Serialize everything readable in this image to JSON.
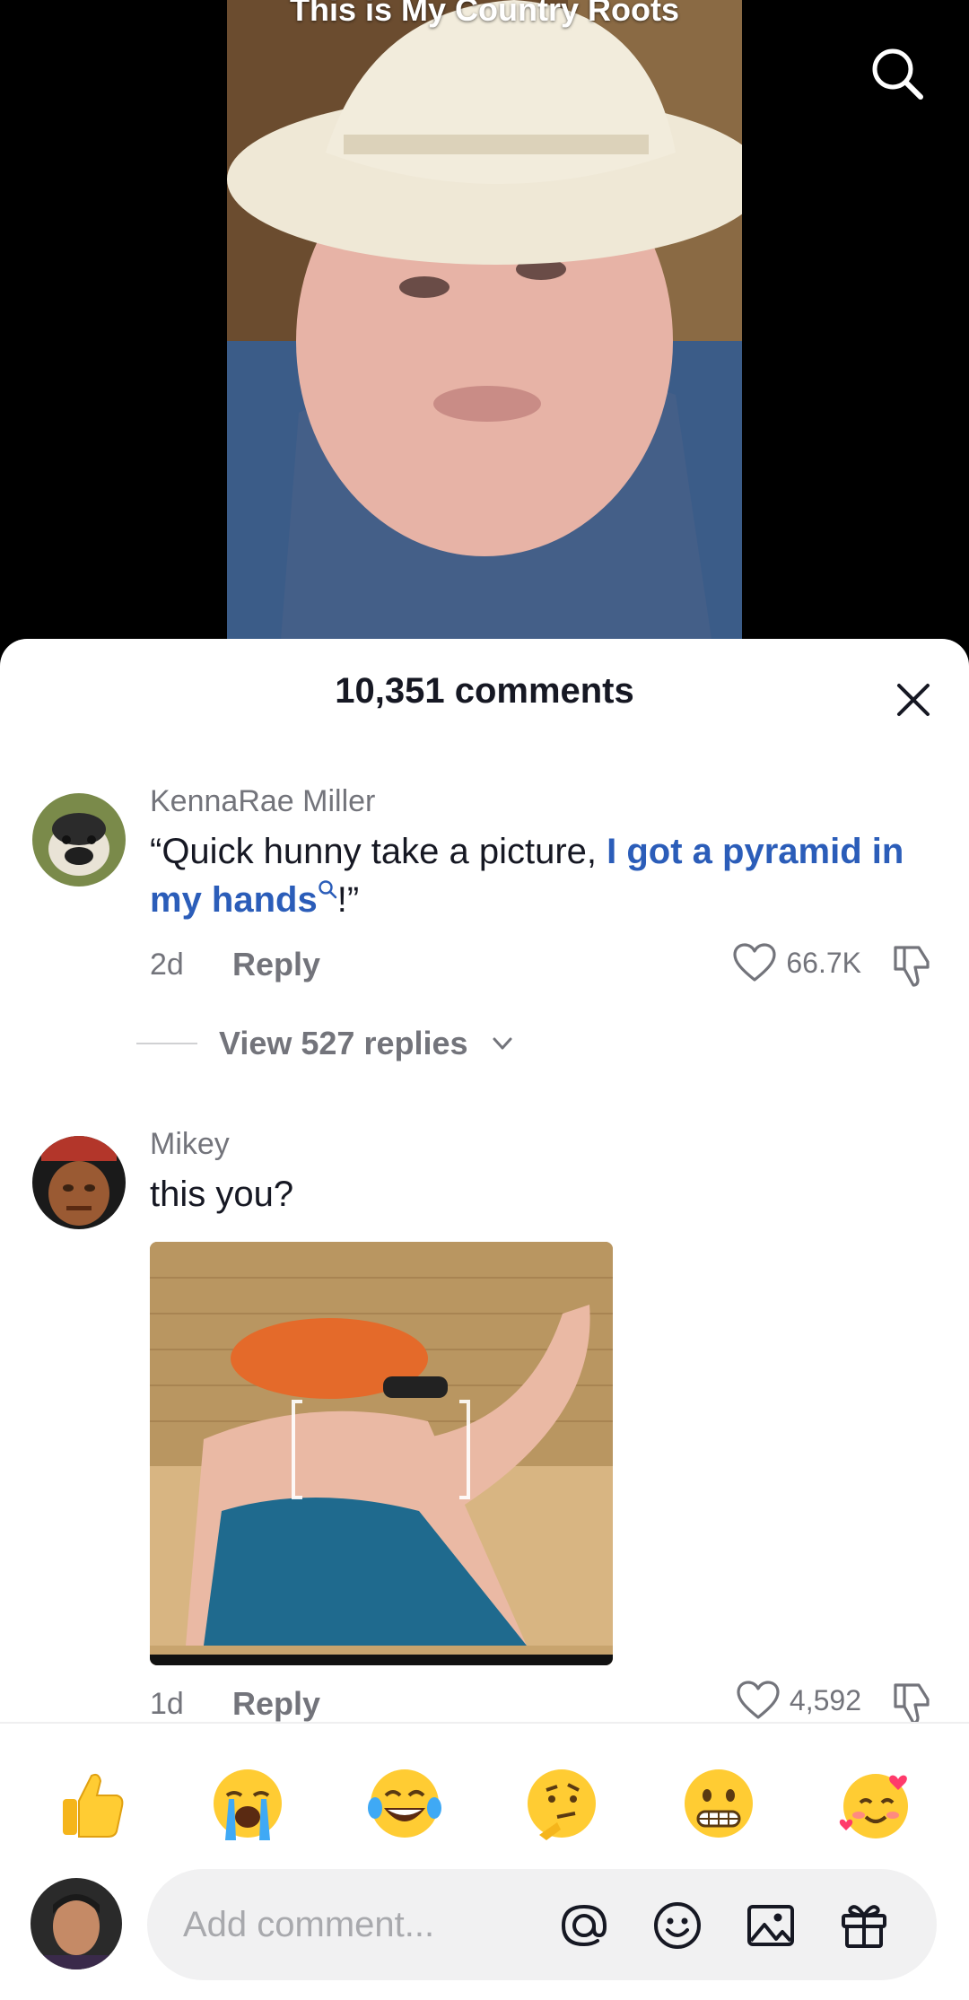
{
  "video": {
    "caption": "This is My Country Roots"
  },
  "comments_sheet": {
    "title": "10,351 comments",
    "comments": [
      {
        "username": "KennaRae Miller",
        "text_before": "“Quick hunny take a picture, ",
        "text_link": "I got a pyramid in my hands",
        "text_after": "!”",
        "age": "2d",
        "reply_label": "Reply",
        "likes": "66.7K",
        "view_replies": "View 527 replies"
      },
      {
        "username": "Mikey",
        "text": "this you?",
        "age": "1d",
        "reply_label": "Reply",
        "likes": "4,592"
      }
    ]
  },
  "emoji_bar": [
    "thumbs-up",
    "loudly-crying",
    "tears-of-joy",
    "thinking",
    "grimacing",
    "smiling-with-hearts"
  ],
  "input": {
    "placeholder": "Add comment..."
  },
  "colors": {
    "link": "#2b5db9",
    "muted": "#73747b",
    "text": "#161823"
  }
}
